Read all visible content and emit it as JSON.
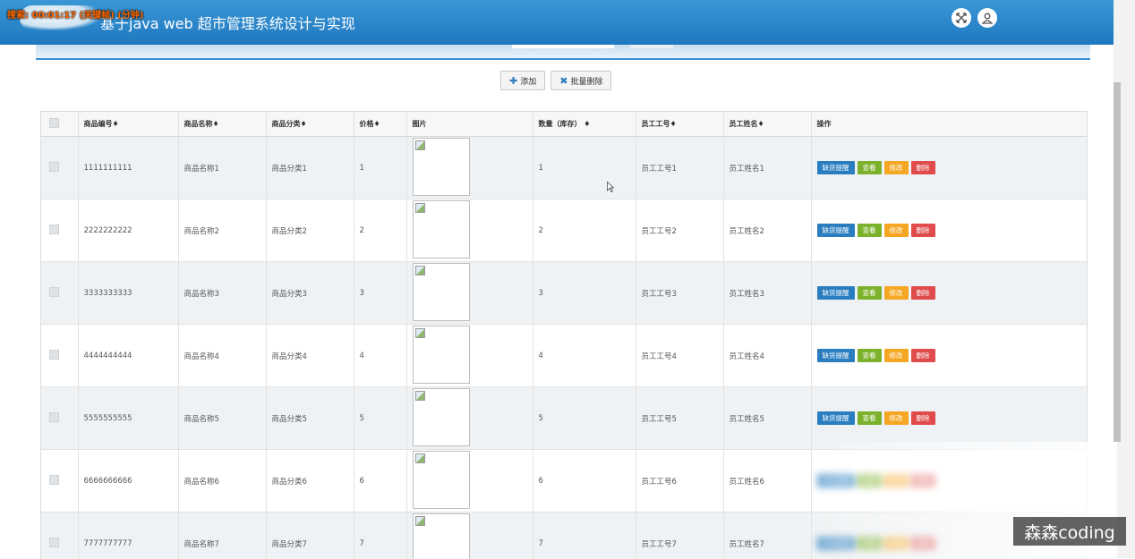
{
  "overlay": "搜索: 00:01:17 (关键帧) (分钟)",
  "header": {
    "title": "基于java web 超市管理系统设计与实现"
  },
  "toolbar": {
    "add_label": "添加",
    "batch_delete_label": "批量删除"
  },
  "table": {
    "columns": [
      "商品编号",
      "商品名称",
      "商品分类",
      "价格",
      "图片",
      "数量（库存）",
      "员工工号",
      "员工姓名",
      "操作"
    ],
    "sort_mark": "♦",
    "rows": [
      {
        "id": "1111111111",
        "name": "商品名称1",
        "category": "商品分类1",
        "price": "1",
        "qty": "1",
        "emp_no": "员工工号1",
        "emp_name": "员工姓名1"
      },
      {
        "id": "2222222222",
        "name": "商品名称2",
        "category": "商品分类2",
        "price": "2",
        "qty": "2",
        "emp_no": "员工工号2",
        "emp_name": "员工姓名2"
      },
      {
        "id": "3333333333",
        "name": "商品名称3",
        "category": "商品分类3",
        "price": "3",
        "qty": "3",
        "emp_no": "员工工号3",
        "emp_name": "员工姓名3"
      },
      {
        "id": "4444444444",
        "name": "商品名称4",
        "category": "商品分类4",
        "price": "4",
        "qty": "4",
        "emp_no": "员工工号4",
        "emp_name": "员工姓名4"
      },
      {
        "id": "5555555555",
        "name": "商品名称5",
        "category": "商品分类5",
        "price": "5",
        "qty": "5",
        "emp_no": "员工工号5",
        "emp_name": "员工姓名5"
      },
      {
        "id": "6666666666",
        "name": "商品名称6",
        "category": "商品分类6",
        "price": "6",
        "qty": "6",
        "emp_no": "员工工号6",
        "emp_name": "员工姓名6"
      },
      {
        "id": "7777777777",
        "name": "商品名称7",
        "category": "商品分类7",
        "price": "7",
        "qty": "7",
        "emp_no": "员工工号7",
        "emp_name": "员工姓名7"
      }
    ],
    "actions": [
      "缺货提醒",
      "查看",
      "修改",
      "删除"
    ]
  },
  "watermark": "森森coding",
  "colors": {
    "header": "#2a86c9",
    "action_blue": "#2a7ec0",
    "action_green": "#7cb12c",
    "action_orange": "#f5a623",
    "action_red": "#e04b4b"
  }
}
